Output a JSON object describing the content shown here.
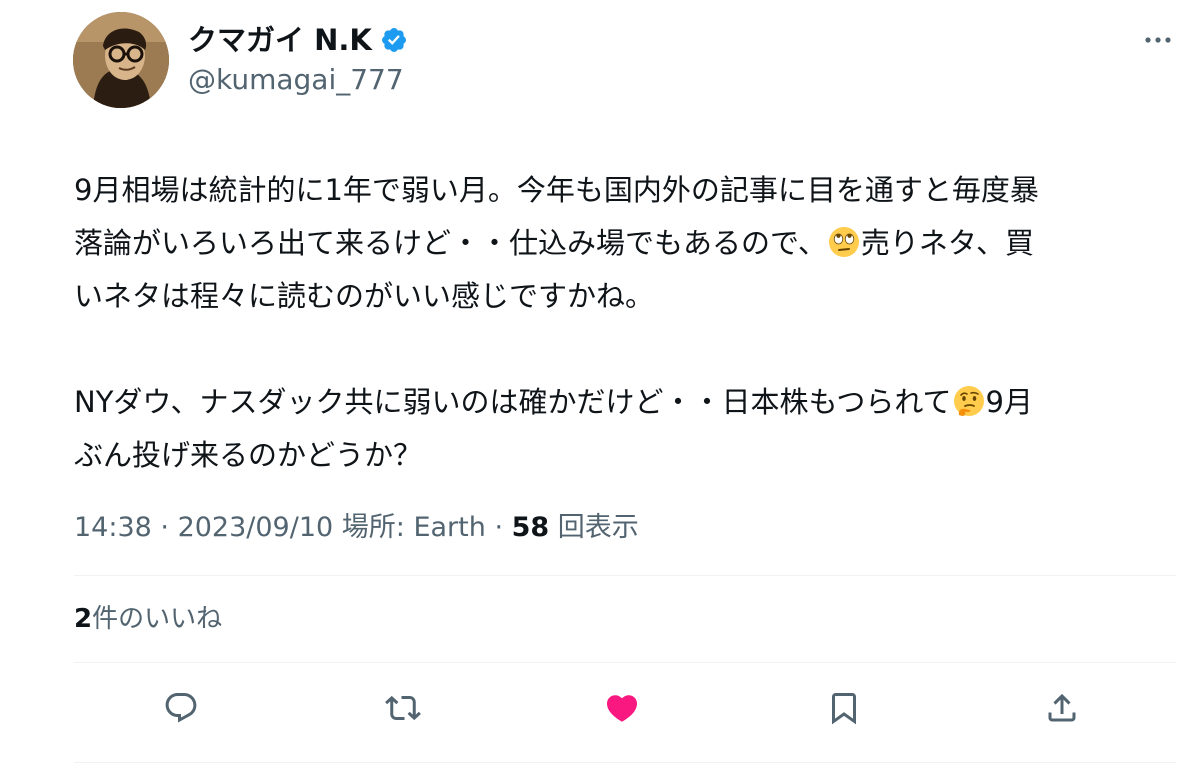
{
  "author": {
    "display_name": "クマガイ N.K",
    "handle": "@kumagai_777",
    "verified": true
  },
  "tweet": {
    "lines": [
      "9月相場は統計的に1年で弱い月。今年も国内外の記事に目を通すと毎度暴",
      "落論がいろいろ出て来るけど・・仕込み場でもあるので、",
      "売りネタ、買",
      "いネタは程々に読むのがいい感じですかね。",
      "NYダウ、ナスダック共に弱いのは確かだけど・・日本株もつられて",
      "9月",
      "ぶん投げ来るのかどうか？"
    ]
  },
  "meta": {
    "time": "14:38",
    "sep1": " · ",
    "date": "2023/09/10",
    "location_label": " 場所: Earth",
    "sep2": " · ",
    "views_count": "58",
    "views_label": " 回表示"
  },
  "likes": {
    "count": "2",
    "label": "件のいいね"
  },
  "icons": {
    "verified": "verified-badge-icon",
    "more": "more-horizontal-icon",
    "reply": "reply-icon",
    "retweet": "retweet-icon",
    "like": "heart-filled-icon",
    "bookmark": "bookmark-icon",
    "share": "share-icon",
    "emoji_1": "face-with-rolling-eyes-emoji",
    "emoji_2": "thinking-face-emoji"
  },
  "colors": {
    "text": "#0f1419",
    "secondary": "#536471",
    "verified": "#1d9bf0",
    "like": "#f91880",
    "divider": "#eff3f4"
  }
}
